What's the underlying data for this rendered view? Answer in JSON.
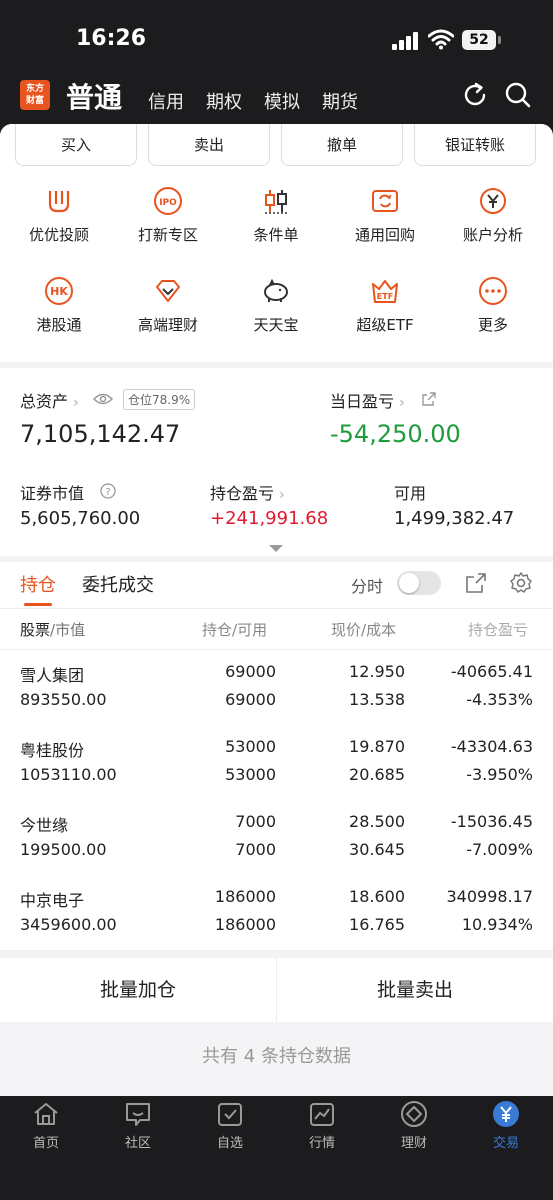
{
  "status": {
    "time": "16:26",
    "battery": "52"
  },
  "header": {
    "logo_line1": "东方",
    "logo_line2": "财富",
    "mode": "普通",
    "tabs": [
      "信用",
      "期权",
      "模拟",
      "期货"
    ]
  },
  "quick_actions": [
    "买入",
    "卖出",
    "撤单",
    "银证转账"
  ],
  "grid_row1": [
    {
      "label": "优优投顾",
      "icon": "uu-advisor-icon"
    },
    {
      "label": "打新专区",
      "icon": "ipo-icon",
      "glyph": "IPO"
    },
    {
      "label": "条件单",
      "icon": "candlestick-icon"
    },
    {
      "label": "通用回购",
      "icon": "repurchase-icon"
    },
    {
      "label": "账户分析",
      "icon": "yen-analysis-icon"
    }
  ],
  "grid_row2": [
    {
      "label": "港股通",
      "icon": "hk-icon",
      "glyph": "HK"
    },
    {
      "label": "高端理财",
      "icon": "diamond-icon"
    },
    {
      "label": "天天宝",
      "icon": "piggy-bank-icon"
    },
    {
      "label": "超级ETF",
      "icon": "etf-crown-icon",
      "glyph": "ETF"
    },
    {
      "label": "更多",
      "icon": "more-icon"
    }
  ],
  "assets": {
    "total_label": "总资产",
    "position_badge": "仓位78.9%",
    "total_value": "7,105,142.47",
    "daily_pnl_label": "当日盈亏",
    "daily_pnl_value": "-54,250.00",
    "market_value_label": "证券市值",
    "market_value": "5,605,760.00",
    "holding_pnl_label": "持仓盈亏",
    "holding_pnl_value": "+241,991.68",
    "available_label": "可用",
    "available_value": "1,499,382.47"
  },
  "holdings_tabs": {
    "active": "持仓",
    "other": "委托成交",
    "toggle_label": "分时"
  },
  "table_header": {
    "col1": "股票",
    "col1b": "/市值",
    "col2": "持仓",
    "col2b": "/可用",
    "col3": "现价",
    "col3b": "/成本",
    "col4": "持仓盈亏"
  },
  "rows": [
    {
      "name": "雪人集团",
      "market_value": "893550.00",
      "position": "69000",
      "available": "69000",
      "price": "12.950",
      "cost": "13.538",
      "pnl": "-40665.41",
      "pnl_pct": "-4.353%",
      "color": "#1e9b3a"
    },
    {
      "name": "粤桂股份",
      "market_value": "1053110.00",
      "position": "53000",
      "available": "53000",
      "price": "19.870",
      "cost": "20.685",
      "pnl": "-43304.63",
      "pnl_pct": "-3.950%",
      "color": "#1e9b3a"
    },
    {
      "name": "今世缘",
      "market_value": "199500.00",
      "position": "7000",
      "available": "7000",
      "price": "28.500",
      "cost": "30.645",
      "pnl": "-15036.45",
      "pnl_pct": "-7.009%",
      "color": "#1e9b3a"
    },
    {
      "name": "中京电子",
      "market_value": "3459600.00",
      "position": "186000",
      "available": "186000",
      "price": "18.600",
      "cost": "16.765",
      "pnl": "340998.17",
      "pnl_pct": "10.934%",
      "color": "#e01b2f"
    }
  ],
  "actions": {
    "add": "批量加仓",
    "sell": "批量卖出"
  },
  "summary": "共有 4 条持仓数据",
  "bottom_nav": [
    {
      "label": "首页",
      "icon": "home-icon"
    },
    {
      "label": "社区",
      "icon": "community-icon"
    },
    {
      "label": "自选",
      "icon": "watchlist-icon"
    },
    {
      "label": "行情",
      "icon": "market-icon"
    },
    {
      "label": "理财",
      "icon": "wealth-icon"
    },
    {
      "label": "交易",
      "icon": "trade-icon",
      "active": true
    }
  ],
  "colors": {
    "accent": "#e8541f",
    "up": "#e01b2f",
    "down": "#1e9b3a",
    "nav_active": "#3a7bd5"
  }
}
